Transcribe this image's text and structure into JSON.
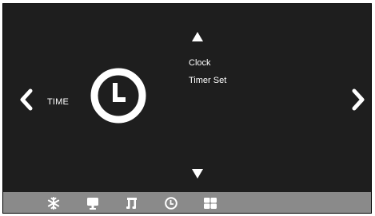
{
  "colors": {
    "background": "#1e1e1e",
    "foreground": "#ffffff",
    "bottom_bar": "#8a8a8a"
  },
  "main": {
    "category_label": "TIME",
    "category_icon": "clock-icon",
    "menu_items": [
      {
        "label": "Clock"
      },
      {
        "label": "Timer Set"
      }
    ]
  },
  "navigation": {
    "left": "chevron-left-icon",
    "right": "chevron-right-icon",
    "up": "triangle-up-icon",
    "down": "triangle-down-icon"
  },
  "bottom_bar": {
    "icons": [
      "snowflake-icon",
      "monitor-icon",
      "music-icon",
      "clock-icon",
      "grid-icon"
    ]
  }
}
